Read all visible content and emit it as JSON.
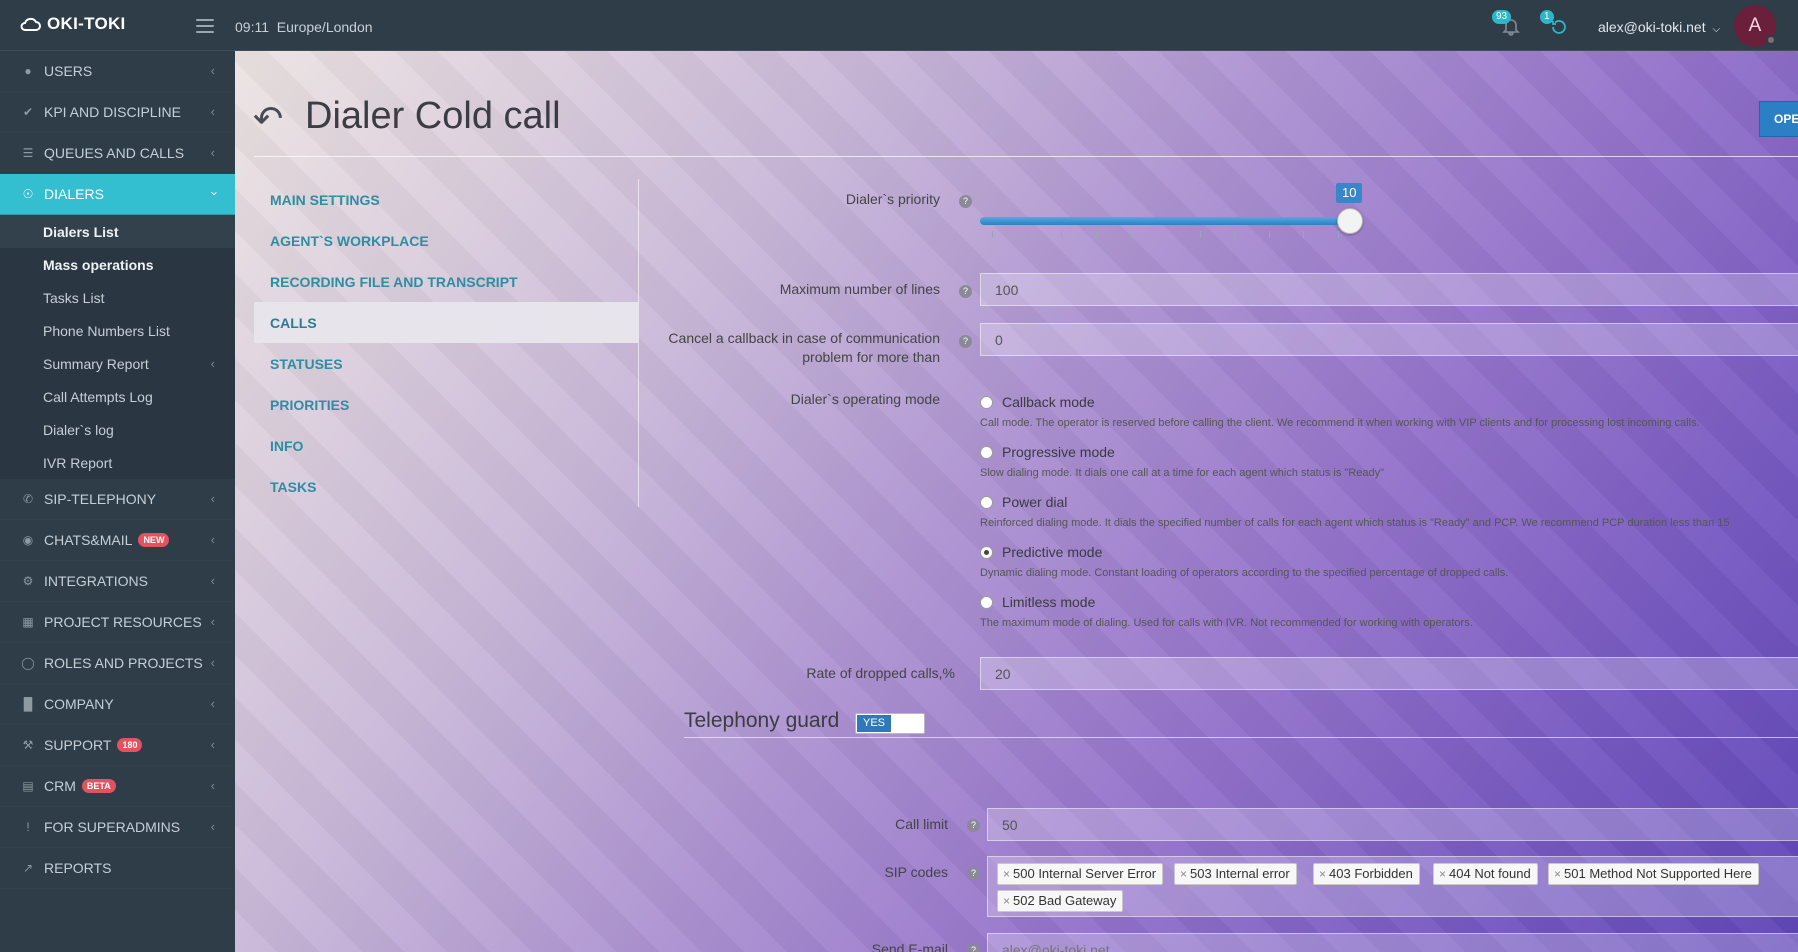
{
  "app": {
    "logo_text": "OKI-TOKI"
  },
  "header": {
    "time": "09:11",
    "timezone": "Europe/London",
    "notifications_count": "93",
    "tasks_count": "1",
    "user_email": "alex@oki-toki.net",
    "avatar_letter": "A"
  },
  "sidebar": {
    "items": [
      {
        "label": "USERS",
        "icon": "user-icon"
      },
      {
        "label": "KPI AND DISCIPLINE",
        "icon": "check-icon"
      },
      {
        "label": "QUEUES AND CALLS",
        "icon": "list-icon"
      },
      {
        "label": "DIALERS",
        "icon": "dialer-icon"
      },
      {
        "label": "SIP-TELEPHONY",
        "icon": "phone-icon"
      },
      {
        "label": "CHATS&MAIL",
        "icon": "chat-icon",
        "badge": "NEW"
      },
      {
        "label": "INTEGRATIONS",
        "icon": "cogs-icon"
      },
      {
        "label": "PROJECT RESOURCES",
        "icon": "grid-icon"
      },
      {
        "label": "ROLES AND PROJECTS",
        "icon": "toggle-icon"
      },
      {
        "label": "COMPANY",
        "icon": "bar-chart-icon"
      },
      {
        "label": "SUPPORT",
        "icon": "wrench-icon",
        "badge": "180"
      },
      {
        "label": "CRM",
        "icon": "crm-icon",
        "badge": "BETA"
      },
      {
        "label": "FOR SUPERADMINS",
        "icon": "exclamation-icon"
      },
      {
        "label": "REPORTS",
        "icon": "line-chart-icon"
      }
    ],
    "dialers_sub": [
      {
        "label": "Dialers List"
      },
      {
        "label": "Mass operations"
      },
      {
        "label": "Tasks List"
      },
      {
        "label": "Phone Numbers List"
      },
      {
        "label": "Summary Report"
      },
      {
        "label": "Call Attempts Log"
      },
      {
        "label": "Dialer`s log"
      },
      {
        "label": "IVR Report"
      }
    ]
  },
  "page": {
    "title": "Dialer Cold call",
    "open_button": "OPE",
    "tabs": [
      {
        "label": "MAIN SETTINGS"
      },
      {
        "label": "AGENT`S WORKPLACE"
      },
      {
        "label": "RECORDING FILE AND TRANSCRIPT"
      },
      {
        "label": "CALLS"
      },
      {
        "label": "STATUSES"
      },
      {
        "label": "PRIORITIES"
      },
      {
        "label": "INFO"
      },
      {
        "label": "TASKS"
      }
    ]
  },
  "form": {
    "priority": {
      "label": "Dialer`s priority",
      "value": 10,
      "value_text": "10",
      "max": 10
    },
    "max_lines": {
      "label": "Maximum number of lines",
      "value": "100"
    },
    "cancel_callback": {
      "label_1": "Cancel a callback in case of communication",
      "label_2": "problem for more than",
      "value": "0"
    },
    "operating_mode": {
      "label": "Dialer`s operating mode",
      "options": [
        {
          "label": "Callback mode",
          "desc": "Call mode. The operator is reserved before calling the client. We recommend it when working with VIP clients and for processing lost incoming calls.",
          "selected": false
        },
        {
          "label": "Progressive mode",
          "desc": "Slow dialing mode. It dials one call at a time for each agent which status is \"Ready\"",
          "selected": false
        },
        {
          "label": "Power dial",
          "desc": "Reinforced dialing mode. It dials the specified number of calls for each agent which status is \"Ready\" and PCP. We recommend PCP duration less than 15",
          "selected": false
        },
        {
          "label": "Predictive mode",
          "desc": "Dynamic dialing mode. Constant loading of operators according to the specified percentage of dropped calls.",
          "selected": true
        },
        {
          "label": "Limitless mode",
          "desc": "The maximum mode of dialing. Used for calls with IVR. Not recommended for working with operators.",
          "selected": false
        }
      ]
    },
    "dropped_rate": {
      "label": "Rate of dropped calls,%",
      "value": "20"
    },
    "guard": {
      "title": "Telephony guard",
      "toggle": "YES",
      "call_limit": {
        "label": "Call limit",
        "value": "50"
      },
      "sip_codes": {
        "label": "SIP codes",
        "tags": [
          "500 Internal Server Error",
          "503 Internal error",
          "403 Forbidden",
          "404 Not found",
          "501 Method Not Supported Here",
          "502 Bad Gateway"
        ]
      },
      "email": {
        "label": "Send E-mail",
        "placeholder": "alex@oki-toki.net"
      }
    }
  },
  "colors": {
    "accent": "#34bfd1",
    "sidebar": "#2f3d48",
    "primary": "#2b7fc4",
    "tab_text": "#2d8ea2"
  }
}
